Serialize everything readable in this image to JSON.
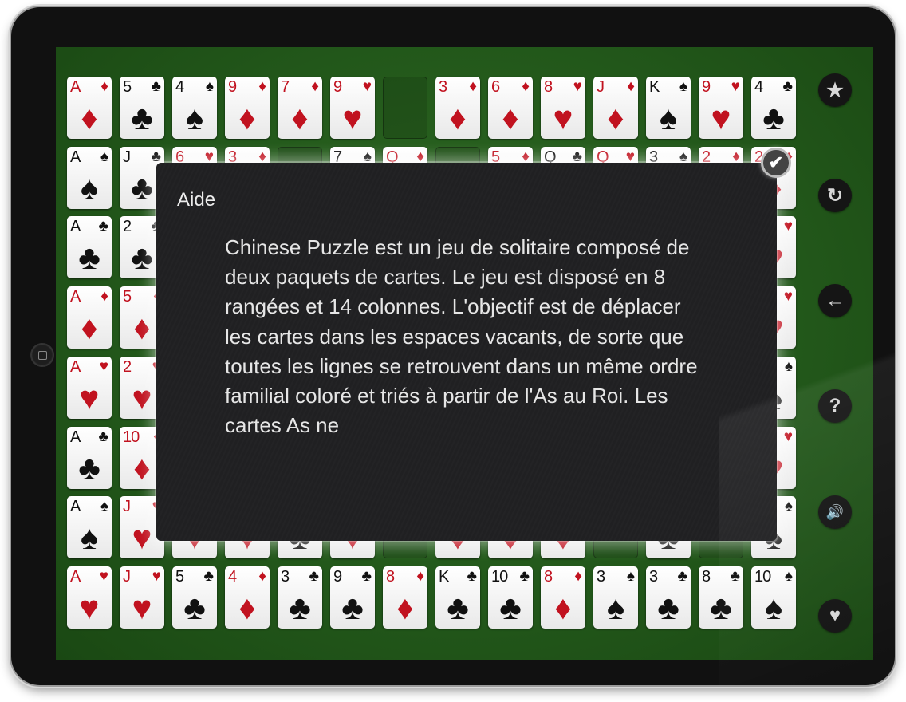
{
  "dialog": {
    "title": "Aide",
    "body": "Chinese Puzzle est un jeu de solitaire composé de deux paquets de cartes. Le jeu est disposé en 8 rangées et 14 colonnes. L'objectif est de déplacer les cartes dans les espaces vacants, de sorte que toutes les lignes se retrouvent dans un même ordre familial coloré et triés à partir de l'As au Roi. Les cartes As ne",
    "close_icon": "check-icon"
  },
  "sidebar": [
    {
      "name": "star-icon",
      "glyph": "★"
    },
    {
      "name": "restart-icon",
      "glyph": "↻"
    },
    {
      "name": "undo-icon",
      "glyph": "←"
    },
    {
      "name": "help-icon",
      "glyph": "?"
    },
    {
      "name": "sound-icon",
      "glyph": "🔊"
    },
    {
      "name": "heart-icon",
      "glyph": "♥"
    }
  ],
  "colors": {
    "red": "#c1121f",
    "black": "#111111",
    "felt": "#22571a"
  },
  "rows": [
    [
      "A♦",
      "5♣",
      "4♠",
      "9♦",
      "7♦",
      "9♥",
      "",
      "3♦",
      "6♦",
      "8♥",
      "J♦",
      "K♠",
      "9♥",
      "4♣"
    ],
    [
      "A♠",
      "J♣",
      "6♥",
      "3♦",
      "",
      "7♠",
      "Q♦",
      "",
      "5♦",
      "Q♣",
      "Q♥",
      "3♠",
      "2♦",
      "2♦"
    ],
    [
      "A♣",
      "2♣",
      "",
      "",
      "",
      "",
      "",
      "",
      "",
      "",
      "",
      "",
      "",
      "7♥"
    ],
    [
      "A♦",
      "5♦",
      "",
      "",
      "",
      "",
      "",
      "",
      "",
      "",
      "",
      "",
      "",
      "7♥"
    ],
    [
      "A♥",
      "2♥",
      "",
      "",
      "",
      "",
      "",
      "",
      "",
      "",
      "",
      "",
      "",
      "6♠"
    ],
    [
      "A♣",
      "10♦",
      "",
      "",
      "",
      "",
      "",
      "",
      "",
      "",
      "",
      "",
      "",
      "5♥"
    ],
    [
      "A♠",
      "J♥",
      "K♥",
      "6♥",
      "4♣",
      "3♥",
      "",
      "3♦",
      "5♦",
      "4♦",
      "",
      "2♣",
      "",
      "3♠"
    ],
    [
      "A♥",
      "J♥",
      "5♣",
      "4♦",
      "3♣",
      "9♣",
      "8♦",
      "K♣",
      "10♣",
      "8♦",
      "3♠",
      "3♣",
      "8♣",
      "10♠"
    ]
  ]
}
